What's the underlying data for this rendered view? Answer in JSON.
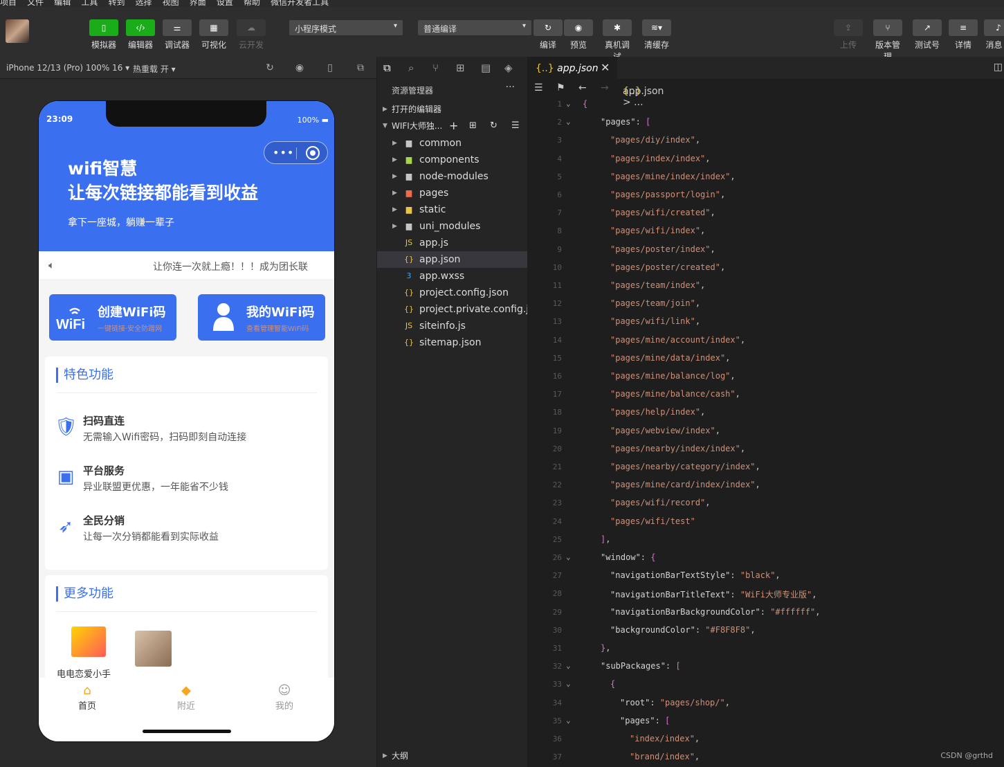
{
  "top_menu": [
    "项目",
    "文件",
    "编辑",
    "工具",
    "转到",
    "选择",
    "视图",
    "界面",
    "设置",
    "帮助",
    "微信开发者工具"
  ],
  "toolbar": {
    "buttons": [
      {
        "label": "模拟器"
      },
      {
        "label": "编辑器"
      },
      {
        "label": "调试器"
      },
      {
        "label": "可视化"
      },
      {
        "label": "云开发"
      }
    ],
    "mode_select": "小程序模式",
    "compile_select": "普通编译",
    "center_buttons": [
      {
        "label": "编译"
      },
      {
        "label": "预览"
      },
      {
        "label": "真机调试"
      },
      {
        "label": "清缓存"
      }
    ],
    "right_buttons": [
      {
        "label": "上传"
      },
      {
        "label": "版本管理"
      },
      {
        "label": "测试号"
      },
      {
        "label": "详情"
      },
      {
        "label": "消息"
      }
    ]
  },
  "sim_bar": {
    "device": "iPhone 12/13 (Pro) 100% 16 ▾",
    "hot_reload": "热重载 开 ▾"
  },
  "phone": {
    "time": "23:09",
    "battery": "100%",
    "hero_title_1": "wifi智慧",
    "hero_title_2": "让每次链接都能看到收益",
    "hero_sub": "拿下一座城，躺赚一辈子",
    "notice": "让你连一次就上瘾！！！成为团长联",
    "btn1_title": "创建WiFi码",
    "btn1_sub": "一键链接·安全防蹭网",
    "btn2_title": "我的WiFi码",
    "btn2_sub": "查看管理智能WiFi码",
    "section1_title": "特色功能",
    "features": [
      {
        "title": "扫码直连",
        "desc": "无需输入Wifi密码，扫码即刻自动连接"
      },
      {
        "title": "平台服务",
        "desc": "异业联盟更优惠，一年能省不少钱"
      },
      {
        "title": "全民分销",
        "desc": "让每一次分销都能看到实际收益"
      }
    ],
    "section2_title": "更多功能",
    "more_1": "电电恋爱小手",
    "tabs": [
      {
        "label": "首页"
      },
      {
        "label": "附近"
      },
      {
        "label": "我的"
      }
    ]
  },
  "explorer": {
    "header": "资源管理器",
    "open_editors": "打开的编辑器",
    "project": "WIFI大师独...",
    "items": [
      {
        "name": "common",
        "type": "folder"
      },
      {
        "name": "components",
        "type": "folder"
      },
      {
        "name": "node-modules",
        "type": "folder"
      },
      {
        "name": "pages",
        "type": "folder"
      },
      {
        "name": "static",
        "type": "folder"
      },
      {
        "name": "uni_modules",
        "type": "folder"
      },
      {
        "name": "app.js",
        "type": "js"
      },
      {
        "name": "app.json",
        "type": "json"
      },
      {
        "name": "app.wxss",
        "type": "css"
      },
      {
        "name": "project.config.json",
        "type": "json"
      },
      {
        "name": "project.private.config.js...",
        "type": "json"
      },
      {
        "name": "siteinfo.js",
        "type": "js"
      },
      {
        "name": "sitemap.json",
        "type": "json"
      }
    ],
    "outline": "大纲"
  },
  "editor": {
    "tab_name": "app.json",
    "breadcrumb": "app.json > ...",
    "pages": [
      "pages/diy/index",
      "pages/index/index",
      "pages/mine/index/index",
      "pages/passport/login",
      "pages/wifi/created",
      "pages/wifi/index",
      "pages/poster/index",
      "pages/poster/created",
      "pages/team/index",
      "pages/team/join",
      "pages/wifi/link",
      "pages/mine/account/index",
      "pages/mine/data/index",
      "pages/mine/balance/log",
      "pages/mine/balance/cash",
      "pages/help/index",
      "pages/webview/index",
      "pages/nearby/index/index",
      "pages/nearby/category/index",
      "pages/mine/card/index/index",
      "pages/wifi/record",
      "pages/wifi/test"
    ],
    "window": [
      {
        "key": "navigationBarTextStyle",
        "value": "black"
      },
      {
        "key": "navigationBarTitleText",
        "value": "WiFi大师专业版"
      },
      {
        "key": "navigationBarBackgroundColor",
        "value": "#ffffff"
      },
      {
        "key": "backgroundColor",
        "value": "#F8F8F8"
      }
    ],
    "sub_root": "pages/shop/",
    "sub_pages": [
      "index/index",
      "brand/index"
    ]
  },
  "watermark": "CSDN @grthd"
}
